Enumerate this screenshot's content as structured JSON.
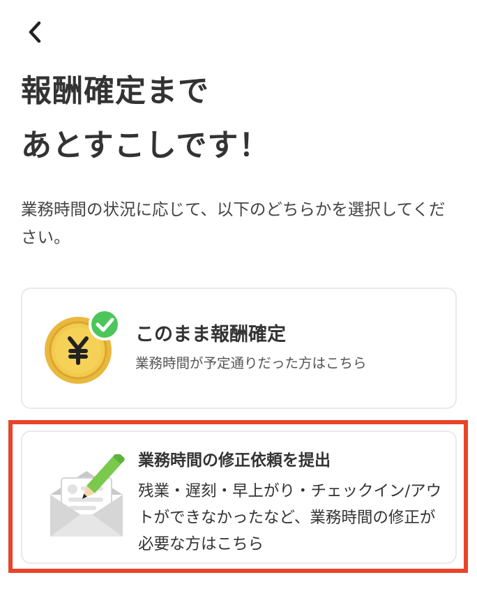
{
  "header": {
    "back_icon": "chevron-left-icon"
  },
  "headline": {
    "line1": "報酬確定まで",
    "line2": "あとすこしです！"
  },
  "instruction": "業務時間の状況に応じて、以下のどちらかを選択してください。",
  "options": [
    {
      "icon": "yen-coin-check-icon",
      "title": "このまま報酬確定",
      "description": "業務時間が予定通りだった方はこちら"
    },
    {
      "icon": "envelope-pencil-icon",
      "title": "業務時間の修正依頼を提出",
      "description": "残業・遅刻・早上がり・チェックイン/アウトができなかったなど、業務時間の修正が必要な方はこちら"
    }
  ],
  "colors": {
    "highlight": "#e8442a",
    "coin": "#e9b93d",
    "check": "#4cc65b",
    "pencil": "#7ac94c",
    "text": "#333333"
  }
}
